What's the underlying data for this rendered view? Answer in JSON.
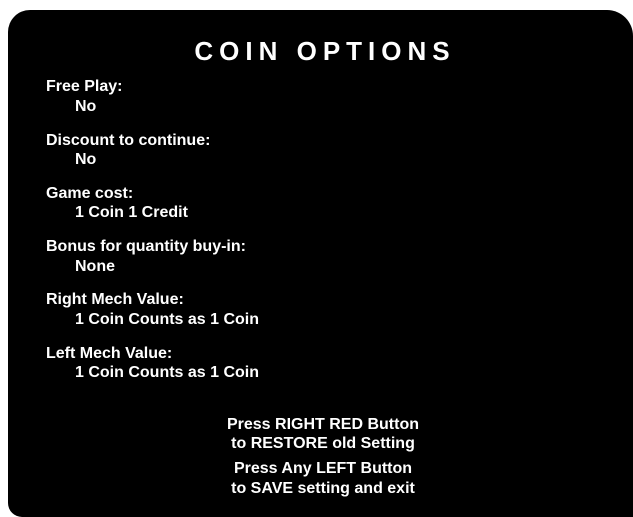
{
  "title": "COIN OPTIONS",
  "options": [
    {
      "label": "Free Play:",
      "value": "No"
    },
    {
      "label": "Discount to continue:",
      "value": "No"
    },
    {
      "label": "Game cost:",
      "value": "1 Coin 1 Credit"
    },
    {
      "label": "Bonus for quantity buy-in:",
      "value": "None"
    },
    {
      "label": "Right Mech Value:",
      "value": "1 Coin Counts as 1 Coin"
    },
    {
      "label": "Left Mech Value:",
      "value": "1 Coin Counts as 1 Coin"
    }
  ],
  "instructions": [
    "Press RIGHT RED Button",
    "to RESTORE old Setting",
    "Press Any LEFT Button",
    "to SAVE setting and exit"
  ]
}
